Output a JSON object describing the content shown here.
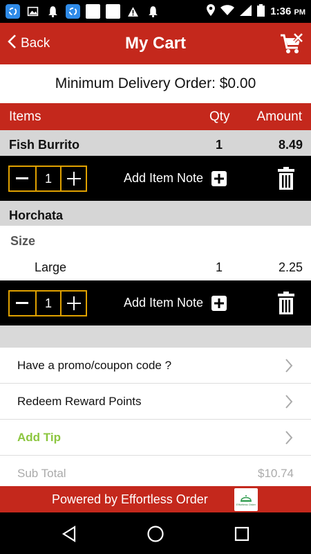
{
  "status_bar": {
    "time": "1:36",
    "ampm": "PM",
    "icons": [
      "app-icon",
      "image-icon",
      "notification-bell-icon",
      "app-icon",
      "blank-square-icon",
      "blank-square-icon",
      "warning-icon",
      "notification-bell-icon",
      "location-icon",
      "wifi-icon",
      "signal-icon",
      "battery-icon"
    ]
  },
  "header": {
    "back_label": "Back",
    "title": "My Cart",
    "clear_cart_icon": "cart-remove-icon"
  },
  "min_order": "Minimum Delivery Order: $0.00",
  "columns": {
    "items": "Items",
    "qty": "Qty",
    "amount": "Amount"
  },
  "cart_items": [
    {
      "name": "Fish Burrito",
      "qty": "1",
      "amount": "8.49",
      "stepper_value": "1",
      "note_label": "Add Item Note"
    },
    {
      "name": "Horchata",
      "option_group": "Size",
      "option_name": "Large",
      "qty": "1",
      "amount": "2.25",
      "stepper_value": "1",
      "note_label": "Add Item Note"
    }
  ],
  "stepper": {
    "minus": "−",
    "plus": "+"
  },
  "actions": {
    "promo": "Have a promo/coupon code ?",
    "redeem": "Redeem Reward Points",
    "tip": "Add Tip"
  },
  "subtotal": {
    "label": "Sub Total",
    "value": "$10.74"
  },
  "footer": {
    "powered_by": "Powered by Effortless Order",
    "logo_text": "Effortless Order"
  },
  "colors": {
    "brand_red": "#c4281c",
    "stepper_border": "#e0a100",
    "tip_green": "#8cc63f"
  }
}
